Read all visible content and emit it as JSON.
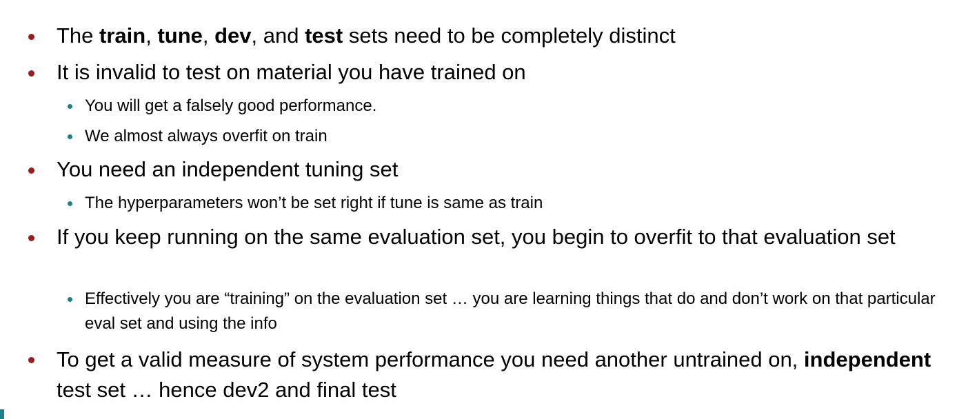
{
  "bullets": {
    "b1": {
      "w1": "The ",
      "train": "train",
      "w2": ", ",
      "tune": "tune",
      "w3": ", ",
      "dev": "dev",
      "w4": ", and ",
      "test": "test",
      "w5": " sets need to be completely distinct"
    },
    "b2": {
      "text": "It is invalid to test on material you have trained on",
      "sub1": "You will get a falsely good performance.",
      "sub2": "We almost always overfit on train"
    },
    "b3": {
      "text": "You need an independent tuning set",
      "sub1": "The hyperparameters won’t be set right if tune is same as train"
    },
    "b4": {
      "text": "If you keep running on the same evaluation set, you begin to overfit to that evaluation set",
      "sub1": "Effectively you are “training” on the evaluation set … you are learning things that do and don’t work on that particular eval set and using the info"
    },
    "b5": {
      "w1": "To get a valid measure of system performance you need another untrained on, ",
      "independent": "independent",
      "w2": " test set … hence dev2 and final test"
    }
  }
}
